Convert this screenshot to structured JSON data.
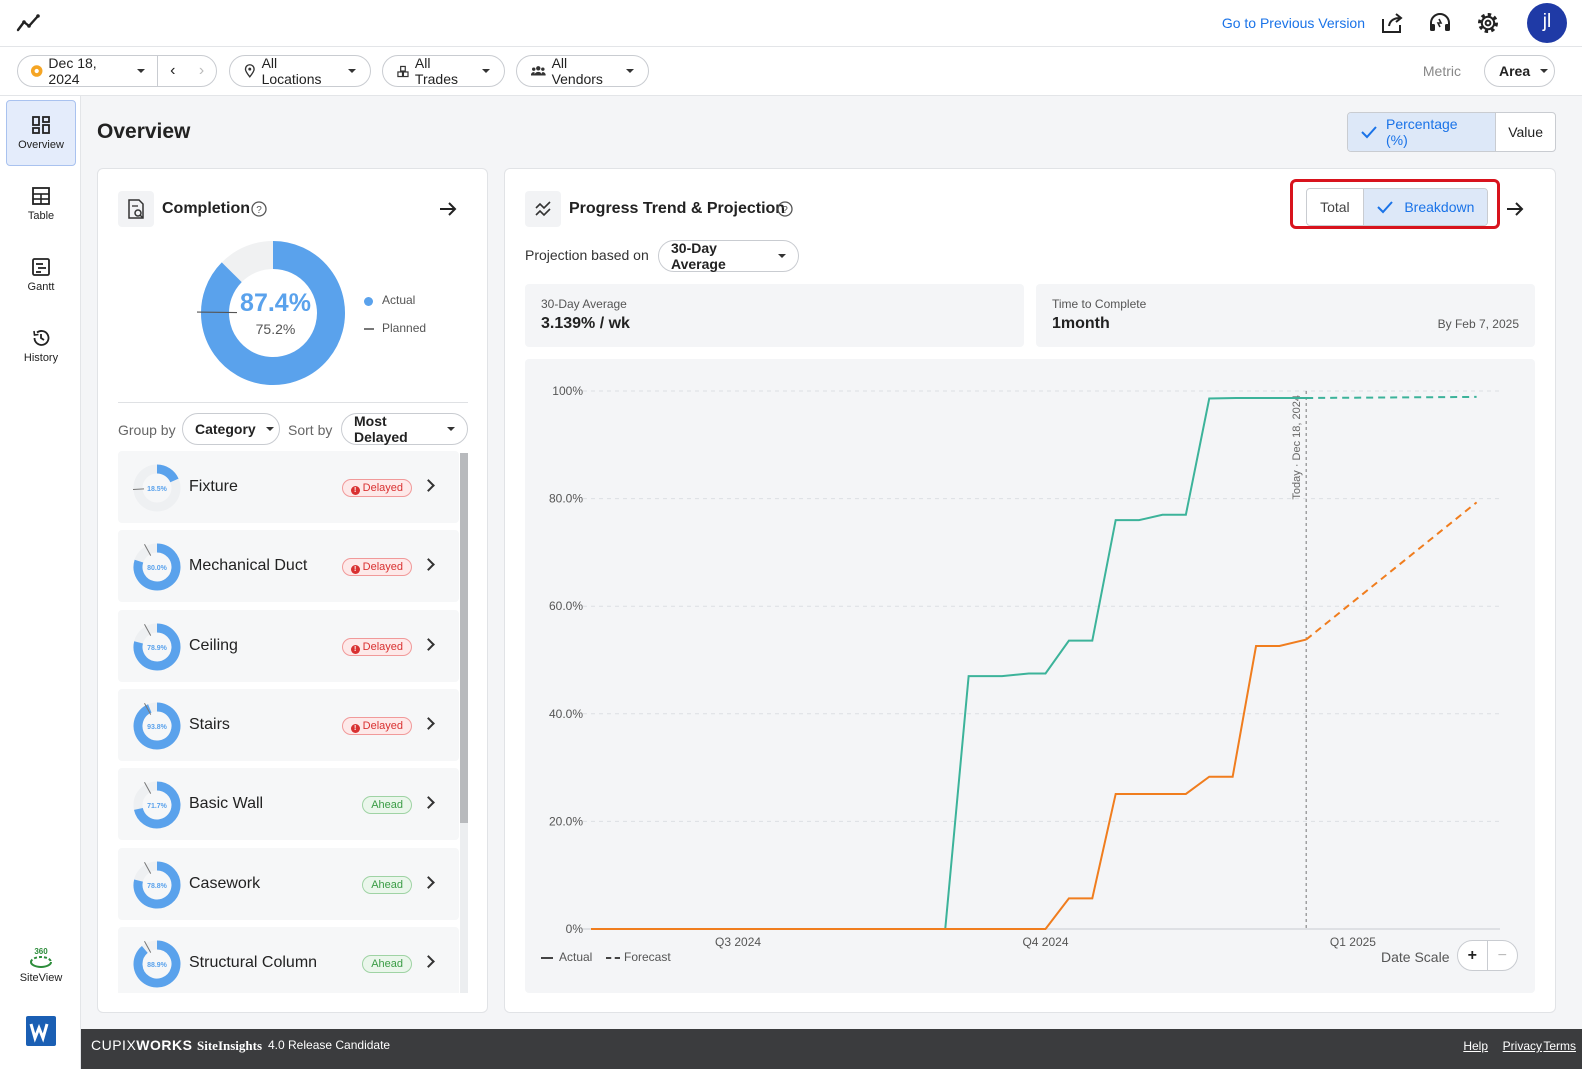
{
  "header": {
    "prev_version_link": "Go to Previous Version",
    "avatar_initials": "jl"
  },
  "filters": {
    "date": "Dec 18, 2024",
    "locations": "All Locations",
    "trades": "All Trades",
    "vendors": "All Vendors",
    "metric_label": "Metric",
    "metric_value": "Area"
  },
  "sidebar": {
    "items": [
      {
        "label": "Overview",
        "active": true
      },
      {
        "label": "Table"
      },
      {
        "label": "Gantt"
      },
      {
        "label": "History"
      }
    ],
    "siteview_label": "SiteView",
    "siteview_badge": "360"
  },
  "main": {
    "title": "Overview",
    "display_toggle": {
      "percentage": "Percentage (%)",
      "value": "Value",
      "selected": "percentage"
    }
  },
  "completion": {
    "title": "Completion",
    "actual_pct": "87.4%",
    "planned_pct": "75.2%",
    "actual_value": 87.4,
    "planned_value": 75.2,
    "legend_actual": "Actual",
    "legend_planned": "Planned",
    "group_by_label": "Group by",
    "group_by_value": "Category",
    "sort_by_label": "Sort by",
    "sort_by_value": "Most Delayed",
    "categories": [
      {
        "name": "Fixture",
        "pct_label": "18.5%",
        "pct": 18.5,
        "status": "Delayed",
        "status_type": "delayed"
      },
      {
        "name": "Mechanical Duct",
        "pct_label": "80.0%",
        "pct": 80.0,
        "status": "Delayed",
        "status_type": "delayed"
      },
      {
        "name": "Ceiling",
        "pct_label": "78.9%",
        "pct": 78.9,
        "status": "Delayed",
        "status_type": "delayed"
      },
      {
        "name": "Stairs",
        "pct_label": "93.8%",
        "pct": 93.8,
        "status": "Delayed",
        "status_type": "delayed"
      },
      {
        "name": "Basic Wall",
        "pct_label": "71.7%",
        "pct": 71.7,
        "status": "Ahead",
        "status_type": "ahead"
      },
      {
        "name": "Casework",
        "pct_label": "78.8%",
        "pct": 78.8,
        "status": "Ahead",
        "status_type": "ahead"
      },
      {
        "name": "Structural Column",
        "pct_label": "88.9%",
        "pct": 88.9,
        "status": "Ahead",
        "status_type": "ahead"
      }
    ]
  },
  "trend": {
    "title": "Progress Trend & Projection",
    "toggle_total": "Total",
    "toggle_breakdown": "Breakdown",
    "toggle_selected": "breakdown",
    "projection_label": "Projection based on",
    "projection_value": "30-Day Average",
    "avg_label": "30-Day Average",
    "avg_value": "3.139% / wk",
    "ttc_label": "Time to Complete",
    "ttc_value": "1month",
    "ttc_by": "By Feb 7, 2025",
    "legend_actual": "Actual",
    "legend_forecast": "Forecast",
    "date_scale_label": "Date Scale",
    "zoom_in": "+",
    "zoom_out": "−"
  },
  "chart_data": {
    "type": "line",
    "y_ticks": [
      "0%",
      "20.0%",
      "40.0%",
      "60.0%",
      "80.0%",
      "100%"
    ],
    "ylim": [
      0,
      100
    ],
    "x_ticks": [
      {
        "label": "Q3 2024",
        "date": "2024-07-01"
      },
      {
        "label": "Q4 2024",
        "date": "2024-10-01"
      },
      {
        "label": "Q1 2025",
        "date": "2025-01-01"
      }
    ],
    "xlim": [
      "2024-05-18",
      "2025-02-14"
    ],
    "today_marker": {
      "label": "Today · Dec 18, 2024",
      "date": "2024-12-18"
    },
    "series": [
      {
        "color": "#3cb39a",
        "actual": [
          [
            "2024-05-18",
            0
          ],
          [
            "2024-09-01",
            0
          ],
          [
            "2024-09-08",
            47
          ],
          [
            "2024-09-18",
            47
          ],
          [
            "2024-09-26",
            47.5
          ],
          [
            "2024-10-01",
            47.5
          ],
          [
            "2024-10-08",
            53.6
          ],
          [
            "2024-10-15",
            53.6
          ],
          [
            "2024-10-22",
            76
          ],
          [
            "2024-10-29",
            76
          ],
          [
            "2024-11-05",
            77
          ],
          [
            "2024-11-12",
            77
          ],
          [
            "2024-11-19",
            98.6
          ],
          [
            "2024-11-27",
            98.7
          ],
          [
            "2024-12-18",
            98.7
          ]
        ],
        "forecast": [
          [
            "2024-12-18",
            98.7
          ],
          [
            "2025-02-07",
            98.9
          ]
        ]
      },
      {
        "color": "#f07d1e",
        "actual": [
          [
            "2024-05-18",
            0
          ],
          [
            "2024-10-01",
            0
          ],
          [
            "2024-10-08",
            5.7
          ],
          [
            "2024-10-15",
            5.7
          ],
          [
            "2024-10-22",
            25.1
          ],
          [
            "2024-11-12",
            25.1
          ],
          [
            "2024-11-19",
            28.3
          ],
          [
            "2024-11-26",
            28.3
          ],
          [
            "2024-12-03",
            52.6
          ],
          [
            "2024-12-10",
            52.6
          ],
          [
            "2024-12-18",
            53.8
          ]
        ],
        "forecast": [
          [
            "2024-12-18",
            53.8
          ],
          [
            "2025-02-07",
            79.3
          ]
        ]
      }
    ]
  },
  "footer": {
    "brand_a": "CUPIX",
    "brand_b": "WORKS",
    "product": "SiteInsights",
    "version": "4.0 Release Candidate",
    "links": [
      "Help",
      "Privacy",
      "Terms"
    ]
  }
}
